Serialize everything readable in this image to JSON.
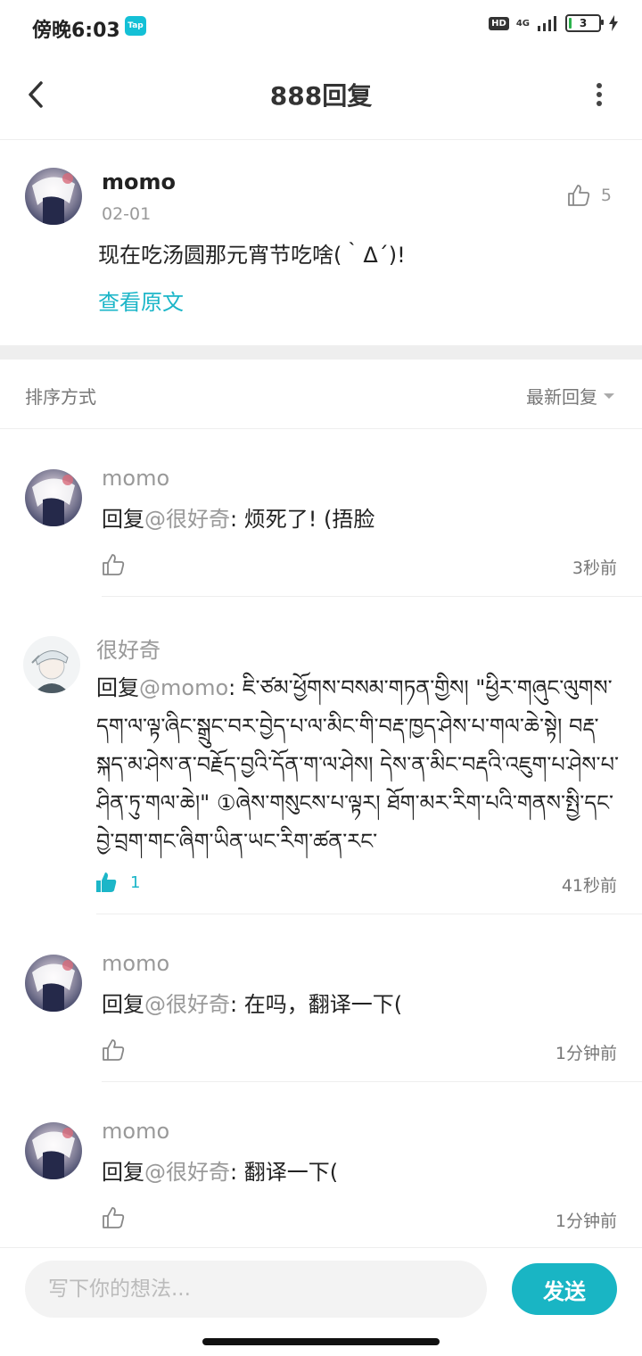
{
  "status_bar": {
    "time": "傍晚6:03",
    "app_badge": "Tap",
    "hd": "HD",
    "network": "4G",
    "battery": "3"
  },
  "header": {
    "title": "888回复",
    "back_icon": "back-arrow-icon",
    "more_icon": "more-vertical-icon"
  },
  "original_post": {
    "author": "momo",
    "date": "02-01",
    "text": "现在吃汤圆那元宵节吃啥(｀Δ´)!",
    "view_original": "查看原文",
    "like_count": "5"
  },
  "sort": {
    "label": "排序方式",
    "value": "最新回复"
  },
  "replies": [
    {
      "author": "momo",
      "prefix": "回复",
      "at": "@很好奇",
      "text": "烦死了! (捂脸",
      "likes": "",
      "time": "3秒前"
    },
    {
      "author": "很好奇",
      "prefix": "回复",
      "at": "@momo",
      "text": "ཇི་ཙམ་ཕྱོགས་བསམ་གཏན་གྱིས། \"ཕྱིར་གཞུང་ལུགས་དག་ལ་ལྟ་ཞིང་སྒྲུང་བར་བྱེད་པ་ལ་མིང་གི་བརྡ་ཁྱད་ཤེས་པ་གལ་ཆེ་སྟེ། བརྡ་སྐད་མ་ཤེས་ན་བརྗོད་བྱའི་དོན་ག་ལ་ཤེས། དེས་ན་མིང་བརྡའི་འཇུག་པ་ཤེས་པ་ཤིན་ཏུ་གལ་ཆེ།\" ①ཞེས་གསུངས་པ་ལྟར། ཐོག་མར་རིག་པའི་གནས་སྤྱི་དང་བྱེ་བྲག་གང་ཞིག་ཡིན་ཡང་རིག་ཚན་རང་",
      "likes": "1",
      "time": "41秒前"
    },
    {
      "author": "momo",
      "prefix": "回复",
      "at": "@很好奇",
      "text": "在吗，翻译一下(",
      "likes": "",
      "time": "1分钟前"
    },
    {
      "author": "momo",
      "prefix": "回复",
      "at": "@很好奇",
      "text": "翻译一下(",
      "likes": "",
      "time": "1分钟前"
    }
  ],
  "composer": {
    "placeholder": "写下你的想法...",
    "send_label": "发送"
  },
  "colors": {
    "accent": "#19b5c4",
    "muted": "#999999"
  }
}
